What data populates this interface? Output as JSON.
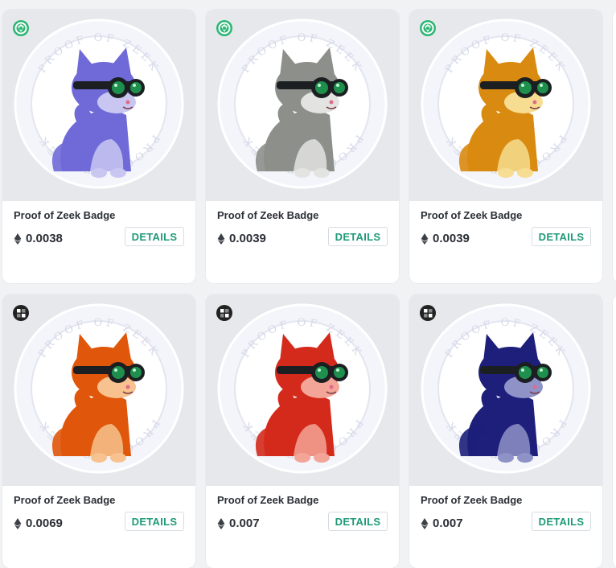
{
  "badge_text": "PROOF OF ZEEK",
  "button_label": "DETAILS",
  "colors": {
    "accent": "#1f9a78",
    "chain_green": "#2bb673",
    "chain_dark": "#222222"
  },
  "cards": [
    {
      "title": "Proof of Zeek Badge",
      "price": "0.0038",
      "chain_icon": "zksync-green-icon",
      "fur": "#6f6ad8",
      "fur_light": "#c9c7f2"
    },
    {
      "title": "Proof of Zeek Badge",
      "price": "0.0039",
      "chain_icon": "zksync-green-icon",
      "fur": "#8d8f8b",
      "fur_light": "#e3e4e1"
    },
    {
      "title": "Proof of Zeek Badge",
      "price": "0.0039",
      "chain_icon": "zksync-green-icon",
      "fur": "#d98a10",
      "fur_light": "#f6dd91"
    },
    {
      "title": "Proof of Zeek Badge",
      "price": "0.0069",
      "chain_icon": "checker-dark-icon",
      "fur": "#e0560a",
      "fur_light": "#f7c28f"
    },
    {
      "title": "Proof of Zeek Badge",
      "price": "0.007",
      "chain_icon": "checker-dark-icon",
      "fur": "#d42a1c",
      "fur_light": "#f3a597"
    },
    {
      "title": "Proof of Zeek Badge",
      "price": "0.007",
      "chain_icon": "checker-dark-icon",
      "fur": "#1d1f7a",
      "fur_light": "#8f92c7"
    }
  ]
}
